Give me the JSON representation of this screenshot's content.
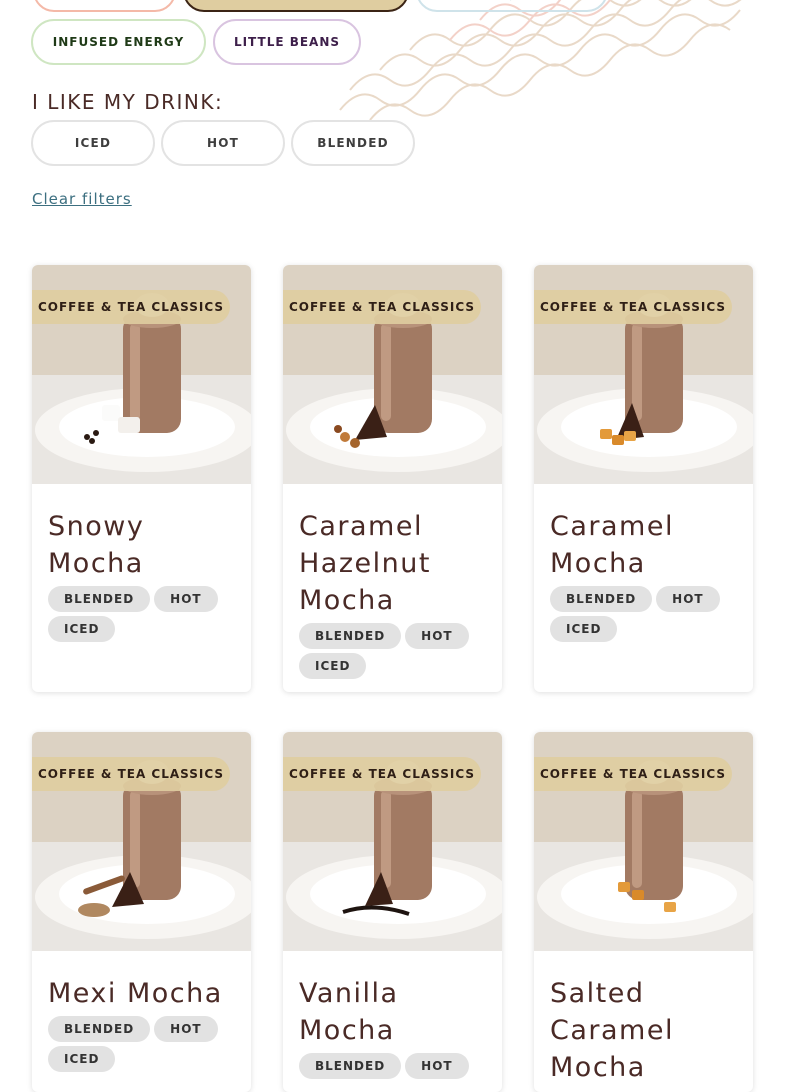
{
  "categories": {
    "infused_energy": "INFUSED ENERGY",
    "little_beans": "LITTLE BEANS"
  },
  "filters": {
    "heading": "I LIKE MY DRINK:",
    "options": [
      "ICED",
      "HOT",
      "BLENDED"
    ],
    "clear_label": "Clear filters"
  },
  "products": [
    {
      "category": "COFFEE & TEA CLASSICS",
      "name": "Snowy Mocha",
      "tags": [
        "BLENDED",
        "HOT",
        "ICED"
      ]
    },
    {
      "category": "COFFEE & TEA CLASSICS",
      "name": "Caramel Hazelnut Mocha",
      "tags": [
        "BLENDED",
        "HOT",
        "ICED"
      ]
    },
    {
      "category": "COFFEE & TEA CLASSICS",
      "name": "Caramel Mocha",
      "tags": [
        "BLENDED",
        "HOT",
        "ICED"
      ]
    },
    {
      "category": "COFFEE & TEA CLASSICS",
      "name": "Mexi Mocha",
      "tags": [
        "BLENDED",
        "HOT",
        "ICED"
      ]
    },
    {
      "category": "COFFEE & TEA CLASSICS",
      "name": "Vanilla Mocha",
      "tags": [
        "BLENDED",
        "HOT"
      ]
    },
    {
      "category": "COFFEE & TEA CLASSICS",
      "name": "Salted Caramel Mocha",
      "tags": []
    }
  ],
  "colors": {
    "brand_text": "#4a2a26",
    "badge_bg": "#dfcda0",
    "infused_border": "#cfe6c2",
    "infused_text": "#1f3a17",
    "little_beans_border": "#d9c4e0",
    "little_beans_text": "#3d1f4a",
    "link": "#3c6f80"
  }
}
